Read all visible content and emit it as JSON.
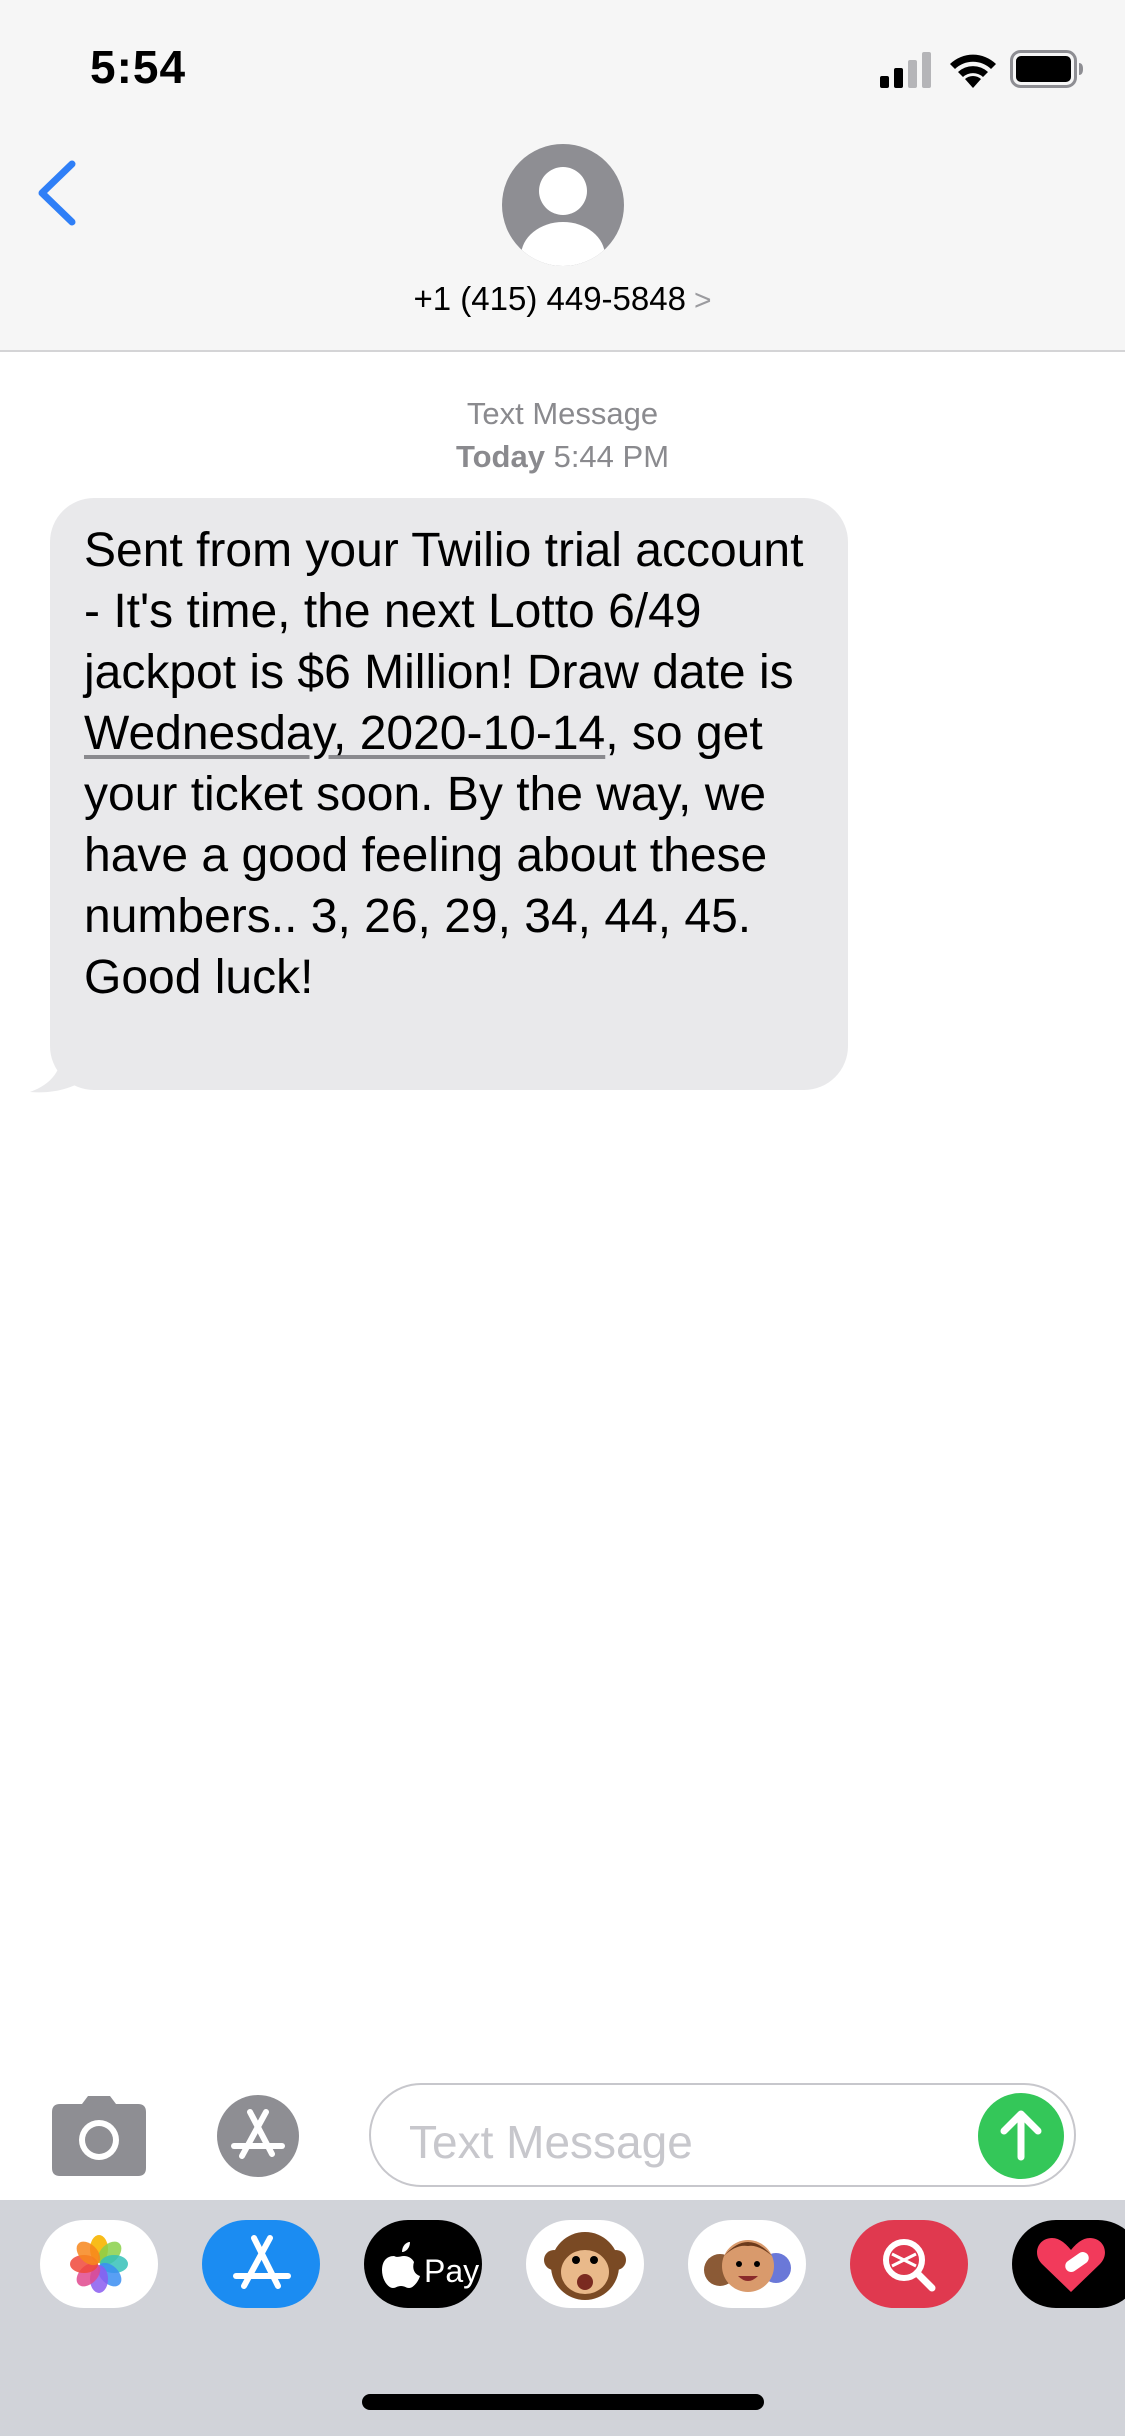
{
  "status_bar": {
    "time": "5:54",
    "icons": [
      "signal-icon",
      "wifi-icon",
      "battery-icon"
    ]
  },
  "header": {
    "back_icon": "chevron-left-icon",
    "avatar_icon": "person-icon",
    "contact_number": "+1 (415) 449-5848",
    "contact_chevron": ">"
  },
  "conversation": {
    "meta_type": "Text Message",
    "meta_day": "Today",
    "meta_time": "5:44 PM",
    "message": {
      "text_before": "Sent from your Twilio trial account - It's time, the next Lotto 6/49 jackpot is $6 Million! Draw date is ",
      "date_link": "Wednesday, 2020-10-14",
      "text_after": ", so get your ticket soon. By the way, we have a good feeling about these numbers.. 3, 26, 29, 34, 44, 45. Good luck!"
    }
  },
  "input_bar": {
    "camera_icon": "camera-icon",
    "apps_icon": "app-store-icon",
    "placeholder": "Text Message",
    "send_icon": "arrow-up-icon"
  },
  "app_drawer": {
    "apps": [
      {
        "name": "photos-icon",
        "bg": "#ffffff"
      },
      {
        "name": "app-store-icon",
        "bg": "#1b8cf2"
      },
      {
        "name": "apple-pay-icon",
        "bg": "#000000",
        "label": "Pay"
      },
      {
        "name": "animoji-monkey-icon",
        "bg": "#ffffff"
      },
      {
        "name": "memoji-icon",
        "bg": "#ffffff"
      },
      {
        "name": "image-search-icon",
        "bg": "#e0394f"
      },
      {
        "name": "digital-touch-icon",
        "bg": "#000000"
      }
    ]
  },
  "colors": {
    "accent_blue": "#2f7ff7",
    "bubble_gray": "#e9e9eb",
    "send_green": "#34c759"
  }
}
